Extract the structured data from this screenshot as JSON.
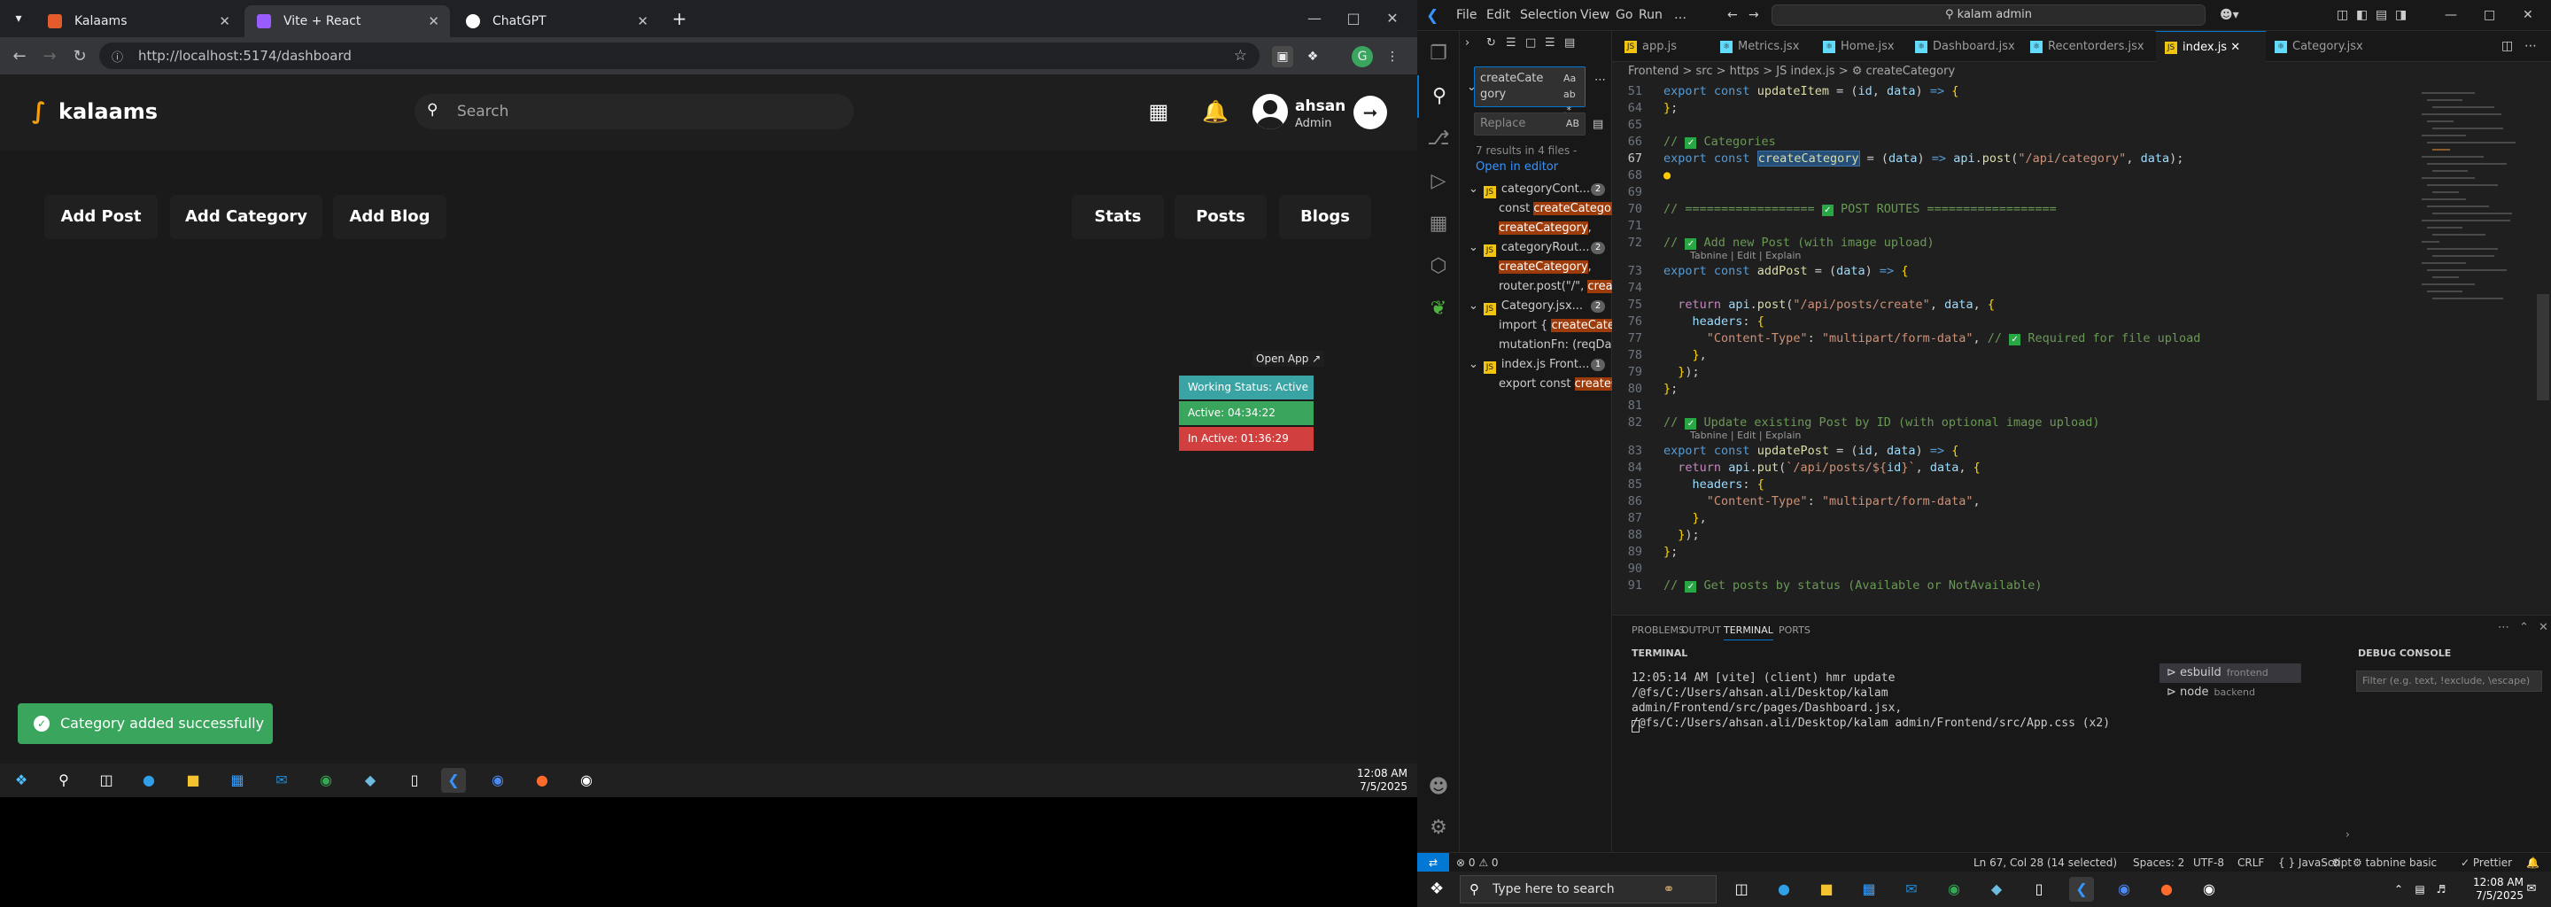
{
  "browser": {
    "tabs": [
      {
        "title": "Kalaams",
        "favicon_color": "#e45c2b"
      },
      {
        "title": "Vite + React",
        "favicon_color": "#9b5cff"
      },
      {
        "title": "ChatGPT",
        "favicon_color": "#ffffff"
      }
    ],
    "url": "http://localhost:5174/dashboard"
  },
  "app": {
    "logo_text": "kalaams",
    "search_placeholder": "Search",
    "user_name": "ahsan",
    "user_role": "Admin",
    "left_buttons": [
      "Add Post",
      "Add Category",
      "Add Blog"
    ],
    "right_buttons": [
      "Stats",
      "Posts",
      "Blogs"
    ],
    "open_app": "Open App ↗",
    "work_status": [
      {
        "label": "Working Status: Active",
        "color": "#3aa3a3"
      },
      {
        "label": "Active: 04:34:22",
        "color": "#3aa55d"
      },
      {
        "label": "In Active: 01:36:29",
        "color": "#d23f3f"
      }
    ],
    "toast": "Category added successfully",
    "accent": "#3aa55d"
  },
  "taskbar_left": {
    "time": "12:08 AM",
    "date": "7/5/2025"
  },
  "vscode": {
    "menu": [
      "File",
      "Edit",
      "Selection",
      "View",
      "Go",
      "Run",
      "…"
    ],
    "command_center": "kalam admin",
    "search": {
      "query": "createCate\ngory",
      "flags": "Aa ab .*",
      "replace_placeholder": "Replace",
      "replace_flag": "AB",
      "summary": "7 results in 4 files -",
      "open_in_editor": "Open in editor",
      "results": [
        {
          "type": "file",
          "name": "categoryCont...",
          "count": "2"
        },
        {
          "type": "line",
          "pre": "const ",
          "match": "createCategory",
          "post": " ="
        },
        {
          "type": "line",
          "pre": "",
          "match": "createCategory",
          "post": ","
        },
        {
          "type": "file",
          "name": "categoryRout...",
          "count": "2"
        },
        {
          "type": "line",
          "pre": "",
          "match": "createCategory",
          "post": ","
        },
        {
          "type": "line",
          "pre": "router.post(\"/\", ",
          "match": "create",
          "post": ""
        },
        {
          "type": "file",
          "name": "Category.jsx...",
          "count": "2"
        },
        {
          "type": "line",
          "pre": "import { ",
          "match": "createCateg",
          "post": ""
        },
        {
          "type": "line",
          "pre": "mutationFn: (reqData...",
          "match": "",
          "post": ""
        },
        {
          "type": "file",
          "name": "index.js  Front...",
          "count": "1"
        },
        {
          "type": "line",
          "pre": "export const ",
          "match": "createC",
          "post": ""
        }
      ]
    },
    "tabs": [
      {
        "name": "app.js",
        "color": "#f1c40f"
      },
      {
        "name": "Metrics.jsx",
        "color": "#61dafb"
      },
      {
        "name": "Home.jsx",
        "color": "#61dafb"
      },
      {
        "name": "Dashboard.jsx",
        "color": "#61dafb"
      },
      {
        "name": "Recentorders.jsx",
        "color": "#61dafb"
      },
      {
        "name": "index.js",
        "color": "#f1c40f"
      },
      {
        "name": "Category.jsx",
        "color": "#61dafb"
      }
    ],
    "active_tab": "index.js",
    "breadcrumb": "Frontend  >  src  >  https  >  JS index.js  >  ⚙ createCategory",
    "panel": {
      "tabs": [
        "PROBLEMS",
        "OUTPUT",
        "TERMINAL",
        "PORTS"
      ],
      "active": "TERMINAL",
      "terminal_title": "TERMINAL",
      "debug_title": "DEBUG CONSOLE",
      "debug_filter": "Filter (e.g. text, !exclude, \\escape)",
      "terminal_output": "12:05:14 AM [vite] (client) hmr update /@fs/C:/Users/ahsan.ali/Desktop/kalam admin/Frontend/src/pages/Dashboard.jsx, /@fs/C:/Users/ahsan.ali/Desktop/kalam admin/Frontend/src/App.css (x2)",
      "terminals": [
        {
          "name": "esbuild",
          "sub": "frontend"
        },
        {
          "name": "node",
          "sub": "backend"
        }
      ]
    },
    "status": {
      "problems": "⊗ 0  ⚠ 0",
      "position": "Ln 67, Col 28 (14 selected)",
      "spaces": "Spaces: 2",
      "encoding": "UTF-8",
      "eol": "CRLF",
      "language": "{ } JavaScript",
      "tabnine": "⚙ tabnine basic",
      "prettier": "✓ Prettier"
    }
  },
  "taskbar_right": {
    "search_placeholder": "Type here to search",
    "time": "12:08 AM",
    "date": "7/5/2025"
  }
}
